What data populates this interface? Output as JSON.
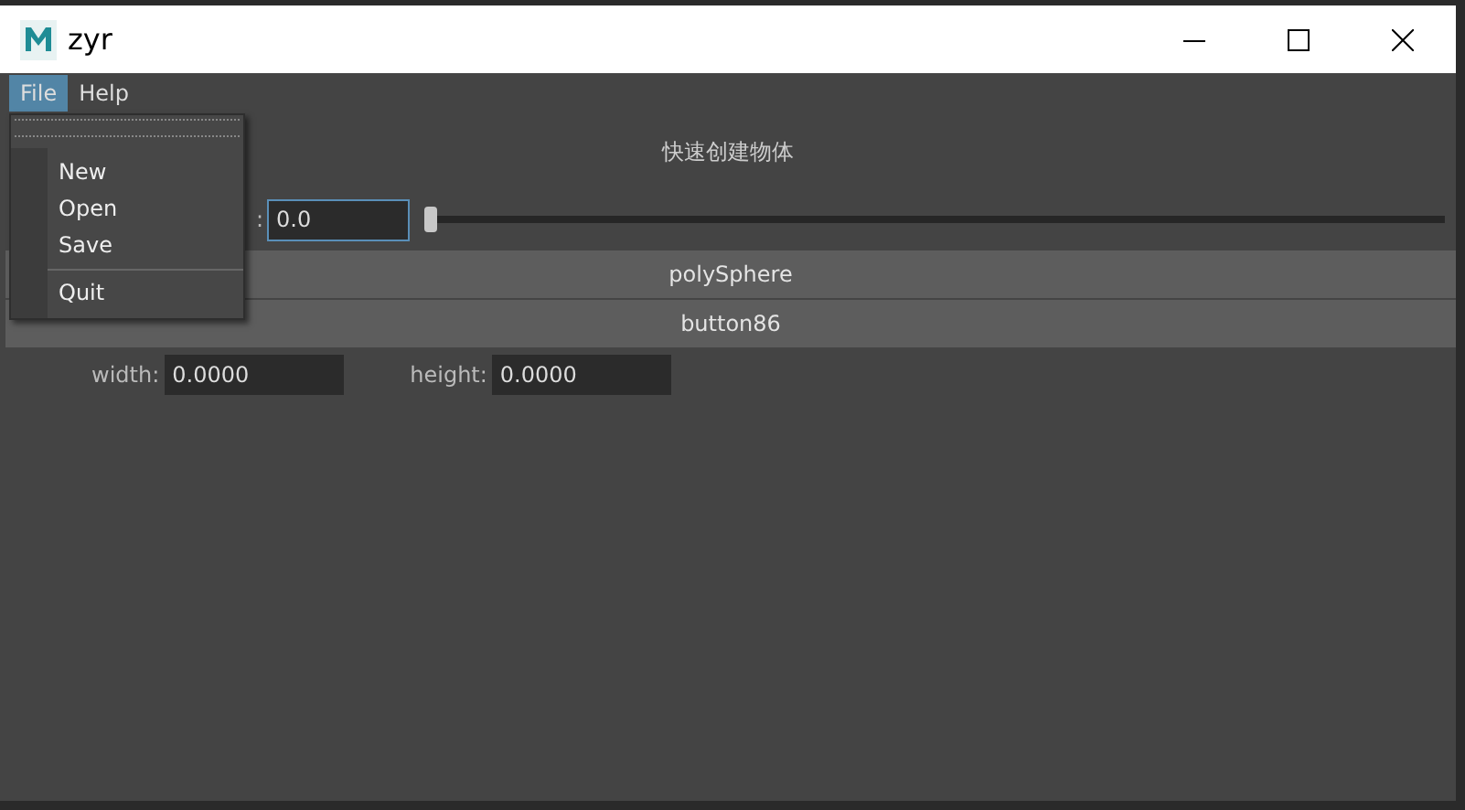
{
  "window": {
    "title": "zyr"
  },
  "menu_bar": [
    {
      "label": "File",
      "selected": true
    },
    {
      "label": "Help",
      "selected": false
    }
  ],
  "file_menu": {
    "items": [
      {
        "kind": "item",
        "label": "New"
      },
      {
        "kind": "item",
        "label": "Open"
      },
      {
        "kind": "item",
        "label": "Save"
      },
      {
        "kind": "separator"
      },
      {
        "kind": "item",
        "label": "Quit"
      }
    ]
  },
  "heading": "快速创建物体",
  "slider": {
    "label": ":",
    "value": "0.0",
    "level": 0
  },
  "buttons": [
    "polySphere",
    "button86"
  ],
  "fields": [
    {
      "label": "width:",
      "value": "0.0000"
    },
    {
      "label": "height:",
      "value": "0.0000"
    }
  ]
}
